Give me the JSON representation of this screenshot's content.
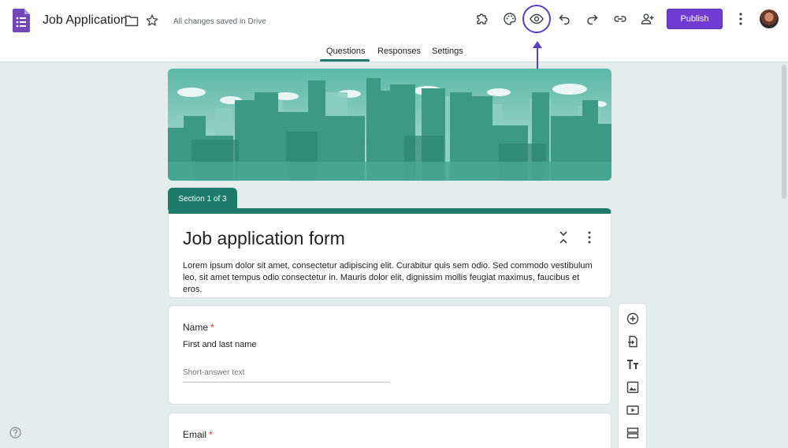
{
  "header": {
    "app_icon": "google-forms-icon",
    "title": "Job Application",
    "saved_status": "All changes saved in Drive",
    "toolbar_icons": [
      "addon-puzzle-icon",
      "palette-icon",
      "eye-preview-icon",
      "undo-icon",
      "redo-icon",
      "link-icon",
      "add-collaborator-icon"
    ],
    "publish_label": "Publish"
  },
  "tabs": {
    "questions": "Questions",
    "responses": "Responses",
    "settings": "Settings",
    "active": "Questions"
  },
  "section": {
    "label": "Section 1 of 3"
  },
  "form": {
    "title": "Job application form",
    "description": "Lorem ipsum dolor sit amet, consectetur adipiscing elit. Curabitur quis sem odio. Sed commodo vestibulum leo, sit amet tempus odio consectetur in. Mauris dolor elit, dignissim mollis feugiat maximus, faucibus et eros."
  },
  "questions": [
    {
      "label": "Name",
      "required_mark": "*",
      "help_text": "First and last name",
      "placeholder": "Short-answer text"
    },
    {
      "label": "Email",
      "required_mark": "*"
    }
  ],
  "side_toolbar": [
    "add-question-icon",
    "import-questions-icon",
    "title-text-icon",
    "image-icon",
    "video-icon",
    "section-icon"
  ],
  "colors": {
    "accent": "#1e7b6b",
    "publish": "#6f3bd0",
    "highlight": "#5b3ec4",
    "background": "#e3eeec"
  }
}
